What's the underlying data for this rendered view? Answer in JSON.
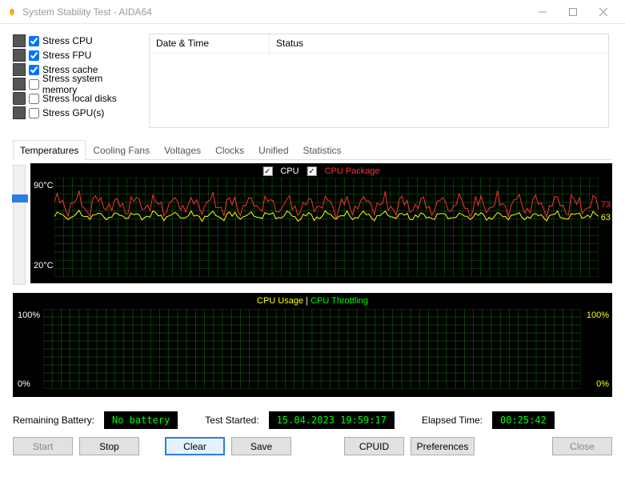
{
  "window": {
    "title": "System Stability Test - AIDA64"
  },
  "stress": {
    "items": [
      {
        "label": "Stress CPU",
        "checked": true
      },
      {
        "label": "Stress FPU",
        "checked": true
      },
      {
        "label": "Stress cache",
        "checked": true
      },
      {
        "label": "Stress system memory",
        "checked": false
      },
      {
        "label": "Stress local disks",
        "checked": false
      },
      {
        "label": "Stress GPU(s)",
        "checked": false
      }
    ]
  },
  "log": {
    "col_date": "Date & Time",
    "col_status": "Status"
  },
  "tabs": {
    "items": [
      "Temperatures",
      "Cooling Fans",
      "Voltages",
      "Clocks",
      "Unified",
      "Statistics"
    ],
    "active": 0
  },
  "chart_data": [
    {
      "type": "line",
      "title": "",
      "legend": [
        {
          "name": "CPU",
          "color": "#ffff00",
          "checked": true
        },
        {
          "name": "CPU Package",
          "color": "#ff3030",
          "checked": true
        }
      ],
      "ylabel": "°C",
      "ylim": [
        20,
        90
      ],
      "ylabels": {
        "top": "90°C",
        "bot": "20°C"
      },
      "series": [
        {
          "name": "CPU",
          "color": "#ffff00",
          "end_value": 63,
          "baseline": 63,
          "jitter": 2
        },
        {
          "name": "CPU Package",
          "color": "#ff3030",
          "end_value": 73,
          "baseline": 71,
          "jitter": 5
        }
      ]
    },
    {
      "type": "line",
      "title": "",
      "legend": [
        {
          "name": "CPU Usage",
          "color": "#ffff00"
        },
        {
          "name": "CPU Throttling",
          "color": "#00ff00"
        }
      ],
      "sep": "|",
      "ylabel": "%",
      "ylim": [
        0,
        100
      ],
      "ylabels": {
        "top": "100%",
        "bot": "0%"
      },
      "right_labels": {
        "top": "100%",
        "bot": "0%",
        "color": "#ffff00"
      },
      "series": [
        {
          "name": "CPU Usage",
          "color": "#ffff00",
          "baseline": 100,
          "jitter": 0
        },
        {
          "name": "CPU Throttling",
          "color": "#00ff00",
          "baseline": 0,
          "jitter": 0
        }
      ]
    }
  ],
  "status": {
    "battery_label": "Remaining Battery:",
    "battery_value": "No battery",
    "started_label": "Test Started:",
    "started_value": "15.04.2023 19:59:17",
    "elapsed_label": "Elapsed Time:",
    "elapsed_value": "00:25:42"
  },
  "buttons": {
    "start": "Start",
    "stop": "Stop",
    "clear": "Clear",
    "save": "Save",
    "cpuid": "CPUID",
    "prefs": "Preferences",
    "close": "Close"
  }
}
